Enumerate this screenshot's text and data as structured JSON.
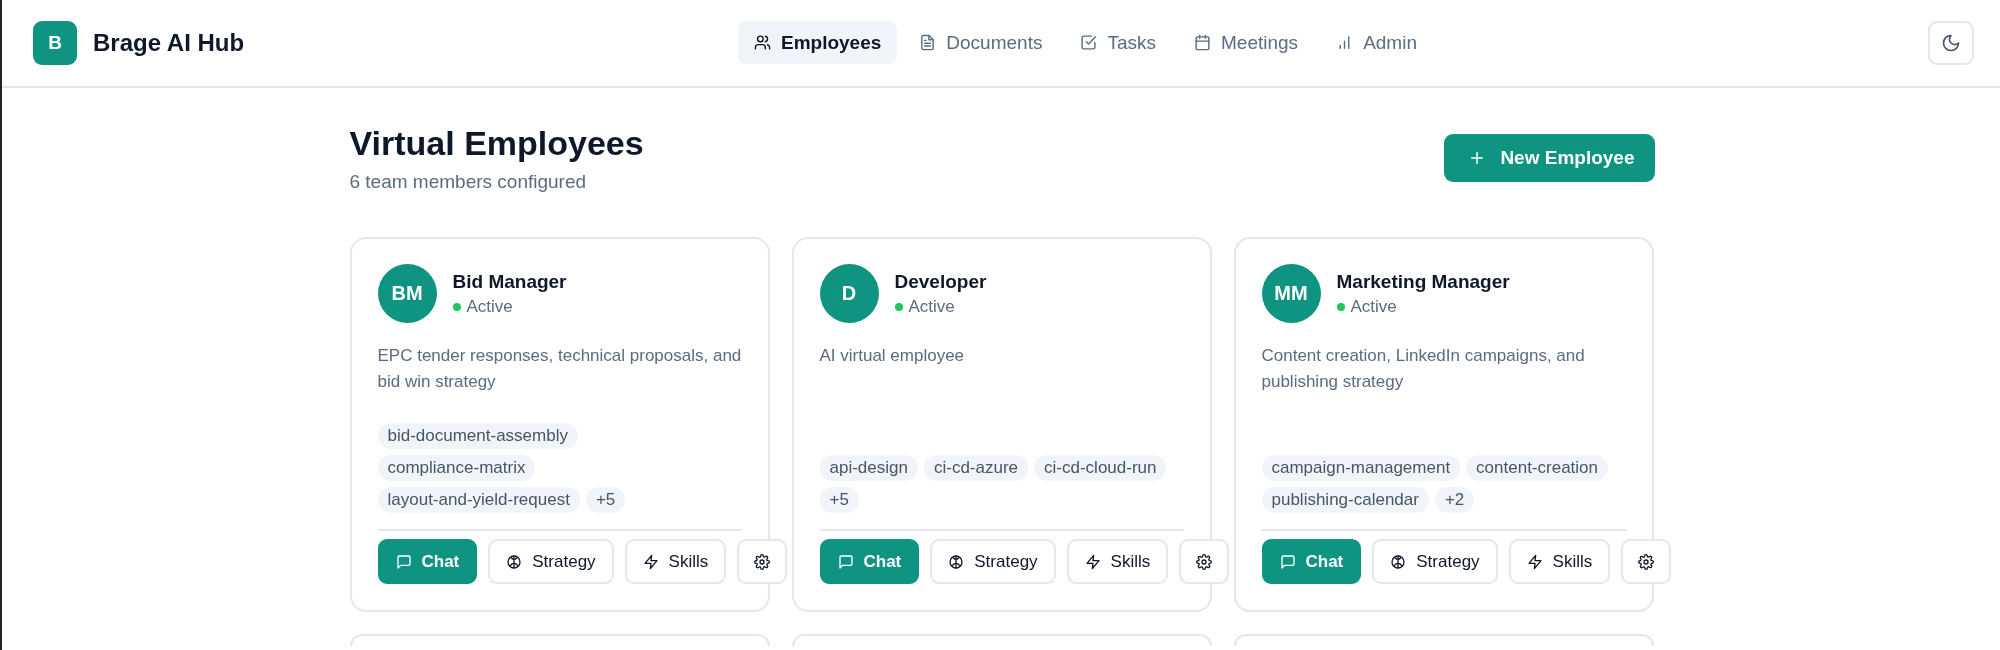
{
  "header": {
    "logo_letter": "B",
    "title": "Brage AI Hub"
  },
  "nav": [
    {
      "label": "Employees",
      "selected": true
    },
    {
      "label": "Documents",
      "selected": false
    },
    {
      "label": "Tasks",
      "selected": false
    },
    {
      "label": "Meetings",
      "selected": false
    },
    {
      "label": "Admin",
      "selected": false
    }
  ],
  "page": {
    "title": "Virtual Employees",
    "subtitle": "6 team members configured",
    "new_button": "New Employee"
  },
  "employees": [
    {
      "kind": "full",
      "initials": "BM",
      "name": "Bid Manager",
      "status": "Active",
      "active": true,
      "description": "EPC tender responses, technical proposals, and bid win strategy",
      "tags": [
        "bid-document-assembly",
        "compliance-matrix",
        "layout-and-yield-request",
        "+5"
      ],
      "actions": [
        {
          "kind": "chat",
          "label": "Chat"
        },
        {
          "kind": "strategy",
          "label": "Strategy"
        },
        {
          "kind": "skills",
          "label": "Skills"
        },
        {
          "kind": "settings"
        }
      ]
    },
    {
      "kind": "full",
      "initials": "D",
      "name": "Developer",
      "status": "Active",
      "active": true,
      "description": "AI virtual employee",
      "tags": [
        "api-design",
        "ci-cd-azure",
        "ci-cd-cloud-run",
        "+5"
      ],
      "actions": [
        {
          "kind": "chat",
          "label": "Chat"
        },
        {
          "kind": "strategy",
          "label": "Strategy"
        },
        {
          "kind": "skills",
          "label": "Skills"
        },
        {
          "kind": "settings"
        }
      ]
    },
    {
      "kind": "full",
      "initials": "MM",
      "name": "Marketing Manager",
      "status": "Active",
      "active": true,
      "description": "Content creation, LinkedIn campaigns, and publishing strategy",
      "tags": [
        "campaign-management",
        "content-creation",
        "publishing-calendar",
        "+2"
      ],
      "actions": [
        {
          "kind": "chat",
          "label": "Chat"
        },
        {
          "kind": "strategy",
          "label": "Strategy"
        },
        {
          "kind": "skills",
          "label": "Skills"
        },
        {
          "kind": "settings"
        }
      ]
    },
    {
      "kind": "cut_off"
    },
    {
      "kind": "cut_off"
    },
    {
      "kind": "cut_off"
    }
  ]
}
